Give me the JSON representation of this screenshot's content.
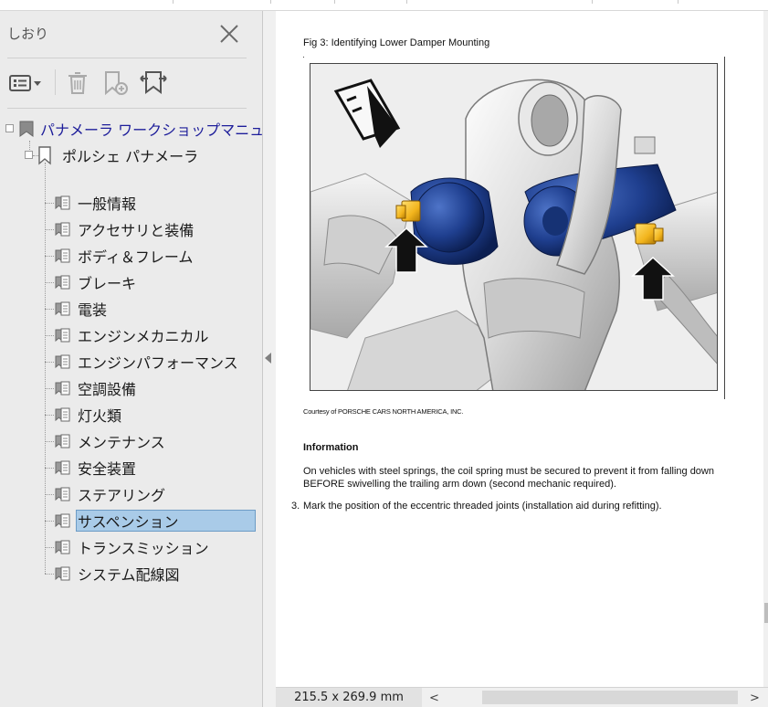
{
  "sidebar": {
    "title": "しおり",
    "toolbar": {
      "options_icon": "list-options-icon",
      "delete_icon": "trash-icon",
      "new_bookmark_icon": "bookmark-add-icon",
      "find_bookmark_icon": "bookmark-find-icon"
    },
    "tree": {
      "root": "パナメーラ ワークショップマニュアル",
      "child": "ポルシェ パナメーラ",
      "items": [
        "一般情報",
        "アクセサリと装備",
        "ボディ＆フレーム",
        "ブレーキ",
        "電装",
        "エンジンメカニカル",
        "エンジンパフォーマンス",
        "空調設備",
        "灯火類",
        "メンテナンス",
        "安全装置",
        "ステアリング",
        "サスペンション",
        "トランスミッション",
        "システム配線図"
      ],
      "selected_index": 12
    }
  },
  "document": {
    "figure_caption": "Fig 3: Identifying Lower Damper Mounting",
    "courtesy": "Courtesy of PORSCHE CARS NORTH AMERICA, INC.",
    "info_heading": "Information",
    "info_text": "On vehicles with steel springs, the coil spring must be secured to prevent it from falling down BEFORE swivelling the trailing arm down (second mechanic required).",
    "step_number": "3.",
    "step_text": "Mark the position of the eccentric threaded joints (installation aid during refitting)."
  },
  "status": {
    "page_size": "215.5 x 269.9 mm",
    "scroll_left": "<",
    "scroll_right": ">"
  },
  "colors": {
    "selection": "#a9cbe8",
    "link_root": "#1d1d9a",
    "damper_blue": "#1f3f8f",
    "bolt_yellow": "#f2b41c"
  }
}
